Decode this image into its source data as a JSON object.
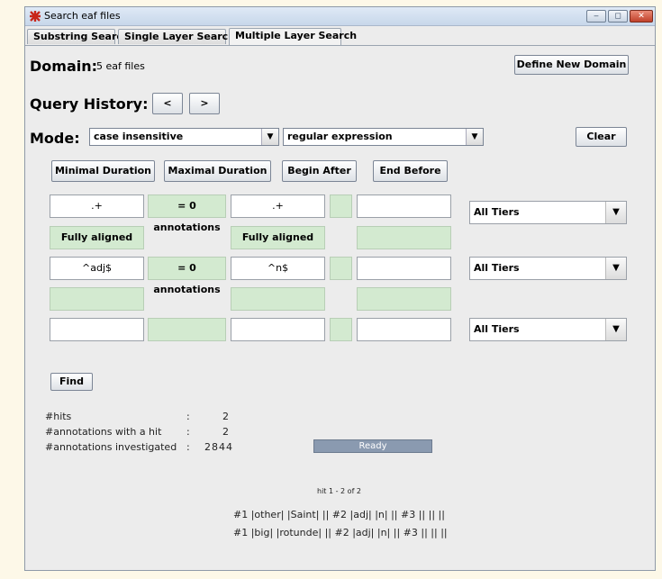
{
  "window": {
    "title": "Search eaf files",
    "controls": [
      "‒",
      "◻",
      "✕"
    ]
  },
  "tabs": [
    {
      "label": "Substring Search",
      "active": false
    },
    {
      "label": "Single Layer Search",
      "active": false
    },
    {
      "label": "Multiple Layer Search",
      "active": true
    }
  ],
  "domain": {
    "label": "Domain:",
    "value": "5 eaf files",
    "define_button": "Define New Domain"
  },
  "history": {
    "label": "Query History:",
    "prev": "<",
    "next": ">"
  },
  "mode": {
    "label": "Mode:",
    "case_value": "case insensitive",
    "regex_value": "regular expression",
    "clear_button": "Clear",
    "arrow": "▼"
  },
  "constraints": {
    "min_duration": "Minimal Duration",
    "max_duration": "Maximal Duration",
    "begin_after": "Begin After",
    "end_before": "End Before"
  },
  "rows": {
    "row1": {
      "f1": ".+",
      "rel": "= 0 annotations",
      "f2": ".+",
      "f3": "",
      "tier": "All Tiers"
    },
    "align1": {
      "a1": "Fully aligned",
      "a2": "Fully aligned"
    },
    "row2": {
      "f1": "^adj$",
      "rel": "= 0 annotations",
      "f2": "^n$",
      "f3": "",
      "tier": "All Tiers"
    },
    "row3": {
      "f1": "",
      "f2": "",
      "f3": "",
      "tier": "All Tiers"
    }
  },
  "find_button": "Find",
  "stats": {
    "hits_label": "#hits",
    "hits_value": "2",
    "ann_hit_label": "#annotations with a hit",
    "ann_hit_value": "2",
    "ann_inv_label": "#annotations investigated",
    "ann_inv_value": "2844",
    "sep": ":"
  },
  "status": {
    "text": "Ready"
  },
  "results": {
    "hit_range": "hit 1 - 2 of 2",
    "lines": [
      "#1 |other| |Saint| ||  #2 |adj| |n| ||  #3 || || ||",
      "#1 |big| |rotunde| ||  #2 |adj| |n| ||  #3 || || ||"
    ]
  },
  "colors": {
    "green": "#d3ead0",
    "progress": "#8a9ab0",
    "background": "#ececec"
  }
}
